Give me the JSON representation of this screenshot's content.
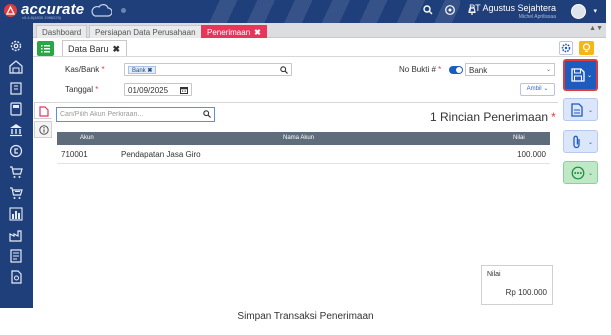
{
  "app": {
    "brand": "accurate",
    "brand_sub": "v5.4.8(4830.1996229)",
    "company": "PT Agustus Sejahtera",
    "user": "Michel Aprilissaa"
  },
  "tabs": [
    {
      "label": "Dashboard"
    },
    {
      "label": "Persiapan Data Perusahaan"
    },
    {
      "label": "Penerimaan"
    }
  ],
  "document_tab": {
    "label": "Data Baru"
  },
  "form": {
    "kas_bank_label": "Kas/Bank",
    "kas_bank_value": "Bank",
    "tanggal_label": "Tanggal",
    "tanggal_value": "01/09/2025",
    "no_bukti_label": "No Bukti #",
    "no_bukti_type": "Bank",
    "ambil_label": "Ambil"
  },
  "details": {
    "search_placeholder": "Cari/Pilih Akun Perkiraan...",
    "title": "1 Rincian Penerimaan",
    "columns": [
      "Akun",
      "Nama Akun",
      "Nilai"
    ],
    "rows": [
      {
        "akun": "710001",
        "nama": "Pendapatan Jasa Giro",
        "nilai": "100.000"
      }
    ]
  },
  "total": {
    "label": "Nilai",
    "value": "Rp 100.000"
  },
  "caption": "Simpan Transaksi Penerimaan",
  "colors": {
    "topbar": "#1f3f7a",
    "active_tab": "#e8365a",
    "primary": "#1d5bbf",
    "success": "#28a745",
    "warning": "#f6b716",
    "highlight": "#e23a3a"
  }
}
